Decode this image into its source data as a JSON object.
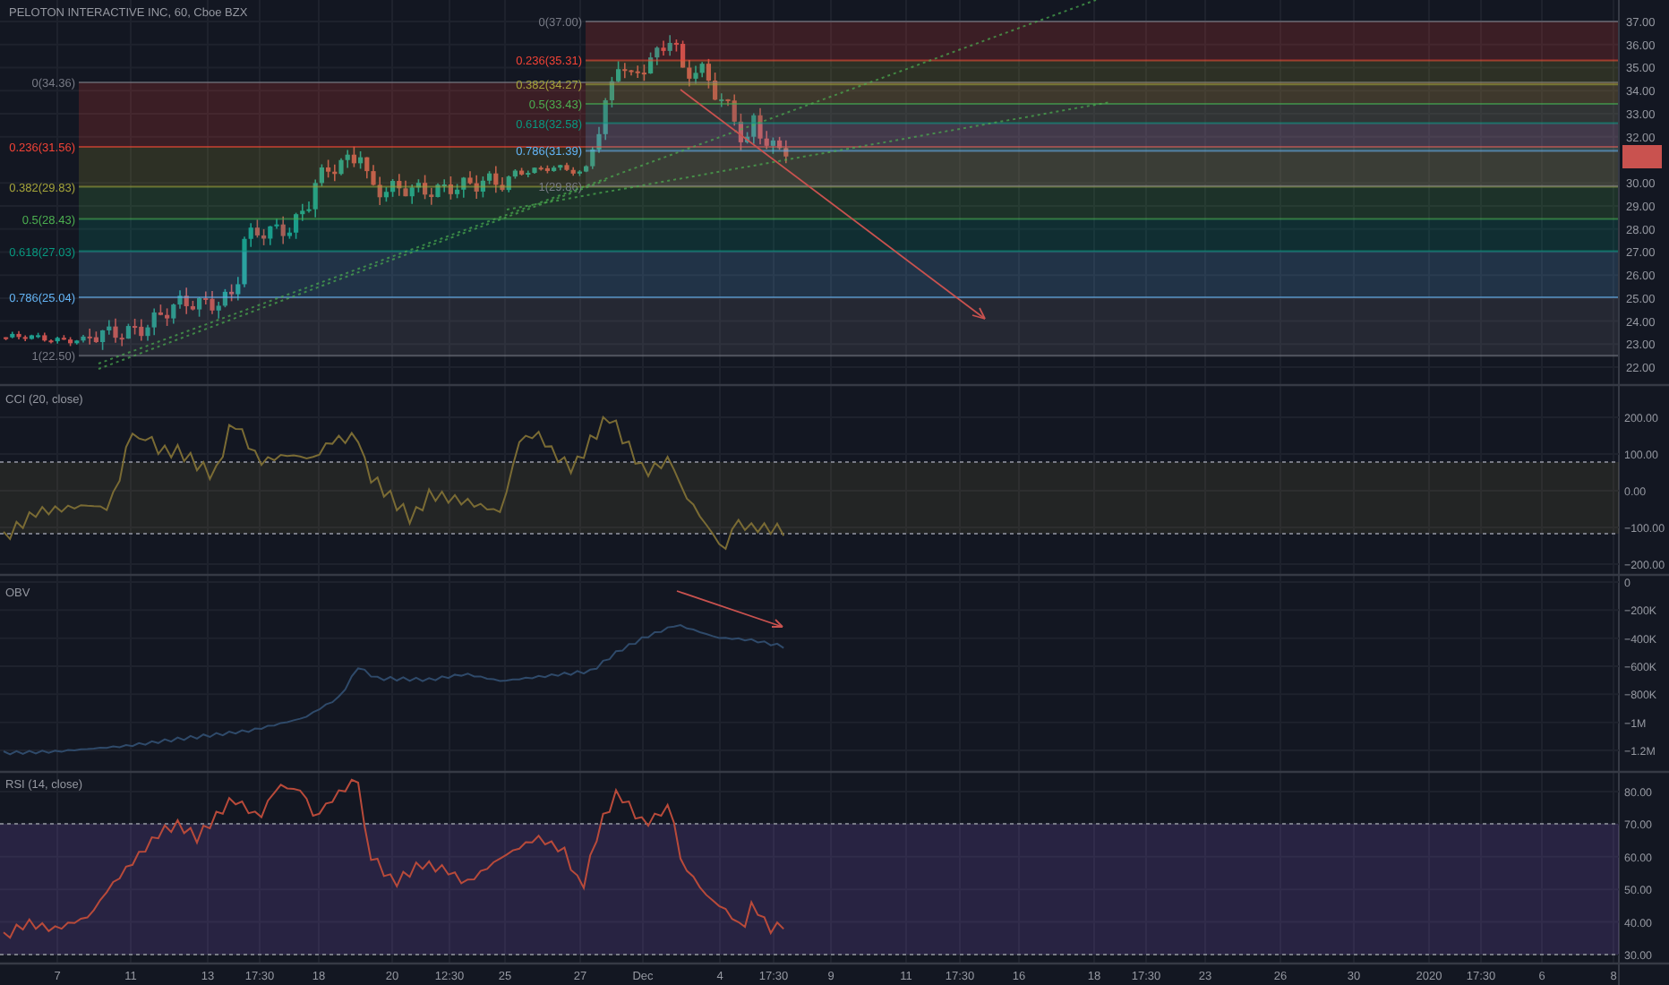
{
  "chart": {
    "title": "PELOTON INTERACTIVE INC, 60, Cboe BZX",
    "price_axis": [
      "37.00",
      "36.00",
      "35.00",
      "34.00",
      "33.00",
      "32.00",
      "30.00",
      "29.00",
      "28.00",
      "27.00",
      "26.00",
      "25.00",
      "24.00",
      "23.00",
      "22.00"
    ],
    "fib_retracements": [
      {
        "levels": [
          {
            "label": "0(34.36)",
            "color": "#787b86"
          },
          {
            "label": "0.236(31.56)",
            "color": "#f44336"
          },
          {
            "label": "0.382(29.83)",
            "color": "#a5a43a"
          },
          {
            "label": "0.5(28.43)",
            "color": "#4caf50"
          },
          {
            "label": "0.618(27.03)",
            "color": "#089981"
          },
          {
            "label": "0.786(25.04)",
            "color": "#64b5f6"
          },
          {
            "label": "1(22.50)",
            "color": "#787b86"
          }
        ]
      },
      {
        "levels": [
          {
            "label": "0(37.00)",
            "color": "#787b86"
          },
          {
            "label": "0.236(35.31)",
            "color": "#f44336"
          },
          {
            "label": "0.382(34.27)",
            "color": "#a5a43a"
          },
          {
            "label": "0.5(33.43)",
            "color": "#4caf50"
          },
          {
            "label": "0.618(32.58)",
            "color": "#089981"
          },
          {
            "label": "0.786(31.39)",
            "color": "#64b5f6"
          },
          {
            "label": "1(29.86)",
            "color": "#787b86"
          }
        ]
      }
    ]
  },
  "indicators": [
    {
      "kind": "cci",
      "title": "CCI (20, close)",
      "axis": [
        "200.00",
        "100.00",
        "0.00",
        "−100.00",
        "−200.00"
      ]
    },
    {
      "kind": "obv",
      "title": "OBV",
      "axis": [
        "0",
        "−200K",
        "−400K",
        "−600K",
        "−800K",
        "−1M",
        "−1.2M"
      ]
    },
    {
      "kind": "rsi",
      "title": "RSI (14, close)",
      "axis": [
        "80.00",
        "70.00",
        "60.00",
        "50.00",
        "40.00",
        "30.00"
      ]
    }
  ],
  "time_axis": [
    "7",
    "11",
    "13",
    "17:30",
    "18",
    "20",
    "12:30",
    "25",
    "27",
    "Dec",
    "4",
    "17:30",
    "9",
    "11",
    "17:30",
    "16",
    "18",
    "17:30",
    "23",
    "26",
    "30",
    "2020",
    "17:30",
    "6",
    "8"
  ]
}
